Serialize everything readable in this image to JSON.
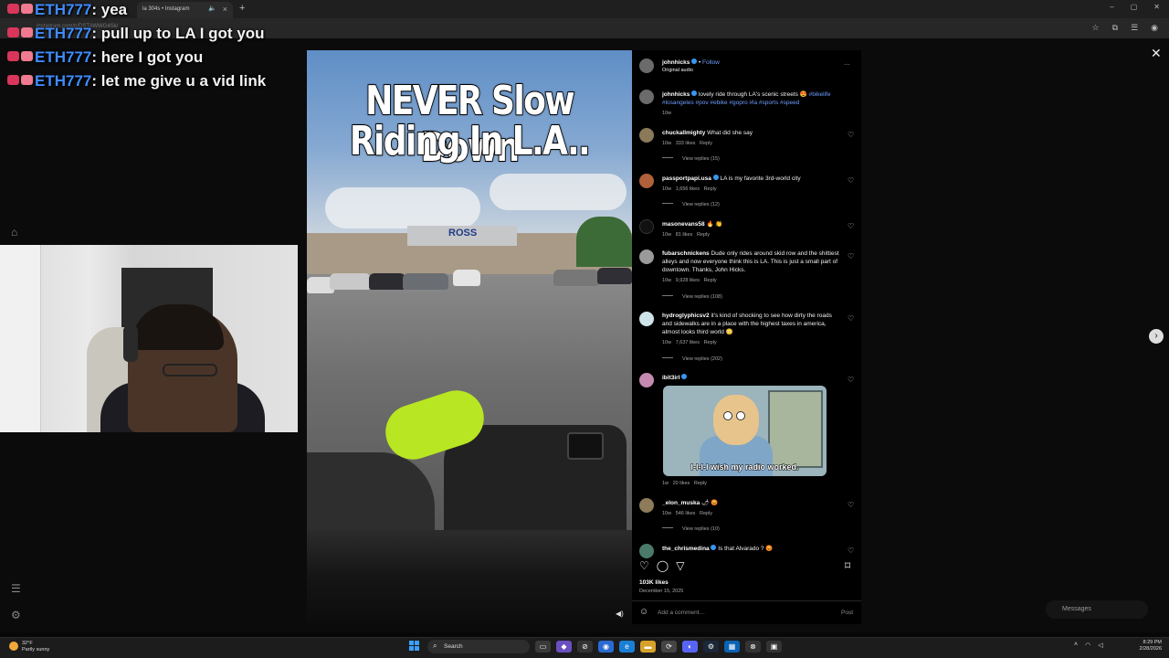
{
  "browser": {
    "tab_title": "la 304s • Instagram",
    "url": "instagram.com/p/DSTAWWG4Sk/",
    "new_tab": "+",
    "tab_close": "×",
    "mute_icon": "🔈",
    "window_controls": [
      "–",
      "▢",
      "✕"
    ]
  },
  "chat": [
    {
      "user": "ETH777",
      "message": "yea"
    },
    {
      "user": "ETH777",
      "message": "pull up to LA I got you"
    },
    {
      "user": "ETH777",
      "message": "here I got you"
    },
    {
      "user": "ETH777",
      "message": "let me give u a vid link"
    }
  ],
  "video": {
    "title_line1": "NEVER Slow Down",
    "title_line2": "Riding In L.A..",
    "store_sign": "ROSS"
  },
  "post": {
    "author": "johnhicks",
    "follow": "Follow",
    "audio": "Original audio",
    "more": "···",
    "caption": "lovely ride through LA's scenic streets 😍",
    "caption_tags1": "#bikelife",
    "caption_tags2": "#losangeles #pov #ebike #gopro #la #sports #speed",
    "caption_age": "10w",
    "likes": "103K likes",
    "date": "December 15, 2025",
    "add_comment": "Add a comment…",
    "post_button": "Post"
  },
  "comments": [
    {
      "user": "chuckallmighty",
      "text": "What did she say",
      "age": "10w",
      "likes": "333 likes",
      "reply": "Reply",
      "replies": "View replies (15)"
    },
    {
      "user": "passportpapi.usa",
      "text": "LA is my favorite 3rd-world city",
      "age": "10w",
      "likes": "1,656 likes",
      "reply": "Reply",
      "replies": "View replies (12)"
    },
    {
      "user": "masonevans58",
      "text": "🔥 👏",
      "age": "10w",
      "likes": "81 likes",
      "reply": "Reply",
      "replies": ""
    },
    {
      "user": "fubarschnickens",
      "text": "Dude only rides around skid row and the shittiest alleys and now everyone think this is LA. This is just a small part of downtown. Thanks, John Hicks.",
      "age": "10w",
      "likes": "9,928 likes",
      "reply": "Reply",
      "replies": "View replies (108)"
    },
    {
      "user": "hydroglyphicsv2",
      "text": "it's kind of shocking to see how dirty the roads and sidewalks are in a place with the highest taxes in america, almost looks third world 😳",
      "age": "10w",
      "likes": "7,637 likes",
      "reply": "Reply",
      "replies": "View replies (202)"
    },
    {
      "user": "ibit3irl",
      "text": "",
      "age": "1w",
      "likes": "20 likes",
      "reply": "Reply",
      "replies": "",
      "meme_caption": "I-I-I-I wish my radio worked."
    },
    {
      "user": "_elon_muska",
      "text": "🌶 😡",
      "age": "10w",
      "likes": "546 likes",
      "reply": "Reply",
      "replies": "View replies (10)"
    },
    {
      "user": "the_chrismedina",
      "text": "Is that Alvarado ? 😡",
      "age": "",
      "likes": "",
      "reply": "",
      "replies": ""
    }
  ],
  "ui": {
    "close": "✕",
    "next": "›",
    "messages": "Messages"
  },
  "taskbar": {
    "weather_temp": "32°F",
    "weather_desc": "Partly sunny",
    "search": "Search",
    "time": "8:29 PM",
    "date": "2/28/2026"
  },
  "colors": {
    "accent_blue": "#3897f0",
    "chat_user": "#3f8cff",
    "glove": "#b8e622"
  }
}
